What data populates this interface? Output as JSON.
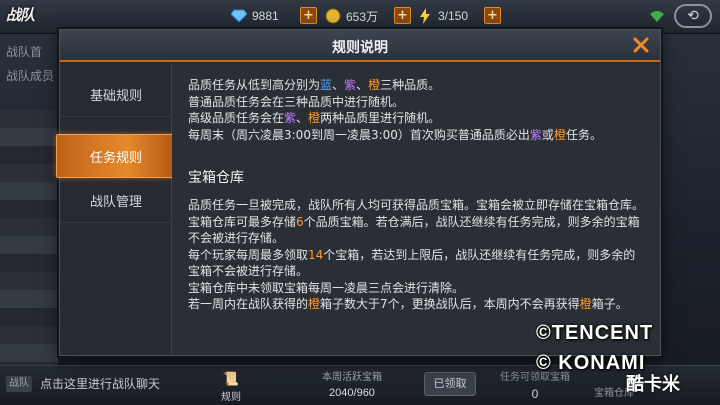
{
  "game": {
    "logo_text": "战队"
  },
  "topbar": {
    "diamonds": "9881",
    "gold": "653万",
    "energy": "3/150",
    "icons": {
      "diamond": "diamond-icon",
      "gold": "coin-icon",
      "energy": "energy-bolt-icon"
    }
  },
  "left_panel": {
    "items": [
      "战队首",
      "战队成员"
    ]
  },
  "modal": {
    "title": "规则说明",
    "close_icon": "close-icon",
    "tabs": [
      "基础规则",
      "任务规则",
      "战队管理"
    ],
    "active_tab": "任务规则",
    "content": {
      "quality_intro": {
        "prefix": "品质任务从低到高分别为",
        "blue": "蓝",
        "sep1": "、",
        "purple": "紫",
        "sep2": "、",
        "orange": "橙",
        "suffix": "三种品质。"
      },
      "line2": "普通品质任务会在三种品质中进行随机。",
      "line3": {
        "prefix": "高级品质任务会在",
        "purple": "紫",
        "sep": "、",
        "orange": "橙",
        "suffix": "两种品质里进行随机。"
      },
      "line4": {
        "prefix": "每周末（周六凌晨3:00到周一凌晨3:00）首次购买普通品质必出",
        "purple": "紫",
        "mid": "或",
        "orange": "橙",
        "suffix": "任务。"
      },
      "section_title": "宝箱仓库",
      "para1": "品质任务一旦被完成，战队所有人均可获得品质宝箱。宝箱会被立即存储在宝箱仓库。",
      "para2": {
        "prefix": "宝箱仓库可最多存储",
        "num": "6",
        "suffix": "个品质宝箱。若仓满后，战队还继续有任务完成，则多余的宝箱不会被进行存储。"
      },
      "para3": {
        "prefix": "每个玩家每周最多领取",
        "num": "14",
        "suffix": "个宝箱，若达到上限后，战队还继续有任务完成，则多余的宝箱不会被进行存储。"
      },
      "para4": "宝箱仓库中未领取宝箱每周一凌晨三点会进行清除。",
      "para5": {
        "prefix": "若一周内在战队获得的",
        "orange1": "橙",
        "mid": "箱子数大于7个，更换战队后，本周内不会再获得",
        "orange2": "橙",
        "suffix": "箱子。"
      }
    }
  },
  "bottombar": {
    "chat_tag": "战队",
    "chat_hint": "点击这里进行战队聊天",
    "rules_label": "规则",
    "weekly_chest_label": "本周活跃宝箱",
    "weekly_chest_value": "2040/960",
    "claimed_label": "已领取",
    "obtainable_label": "任务可领取宝箱",
    "obtainable_value": "0",
    "store_label": "宝箱仓库"
  },
  "watermark": {
    "line1": "©TENCENT",
    "line2": "© KONAMI",
    "line3": "酷卡米"
  },
  "colors": {
    "accent": "#e58a2b",
    "blue": "#4fa6ff",
    "purple": "#c17cff",
    "orange": "#ff9a2e"
  }
}
